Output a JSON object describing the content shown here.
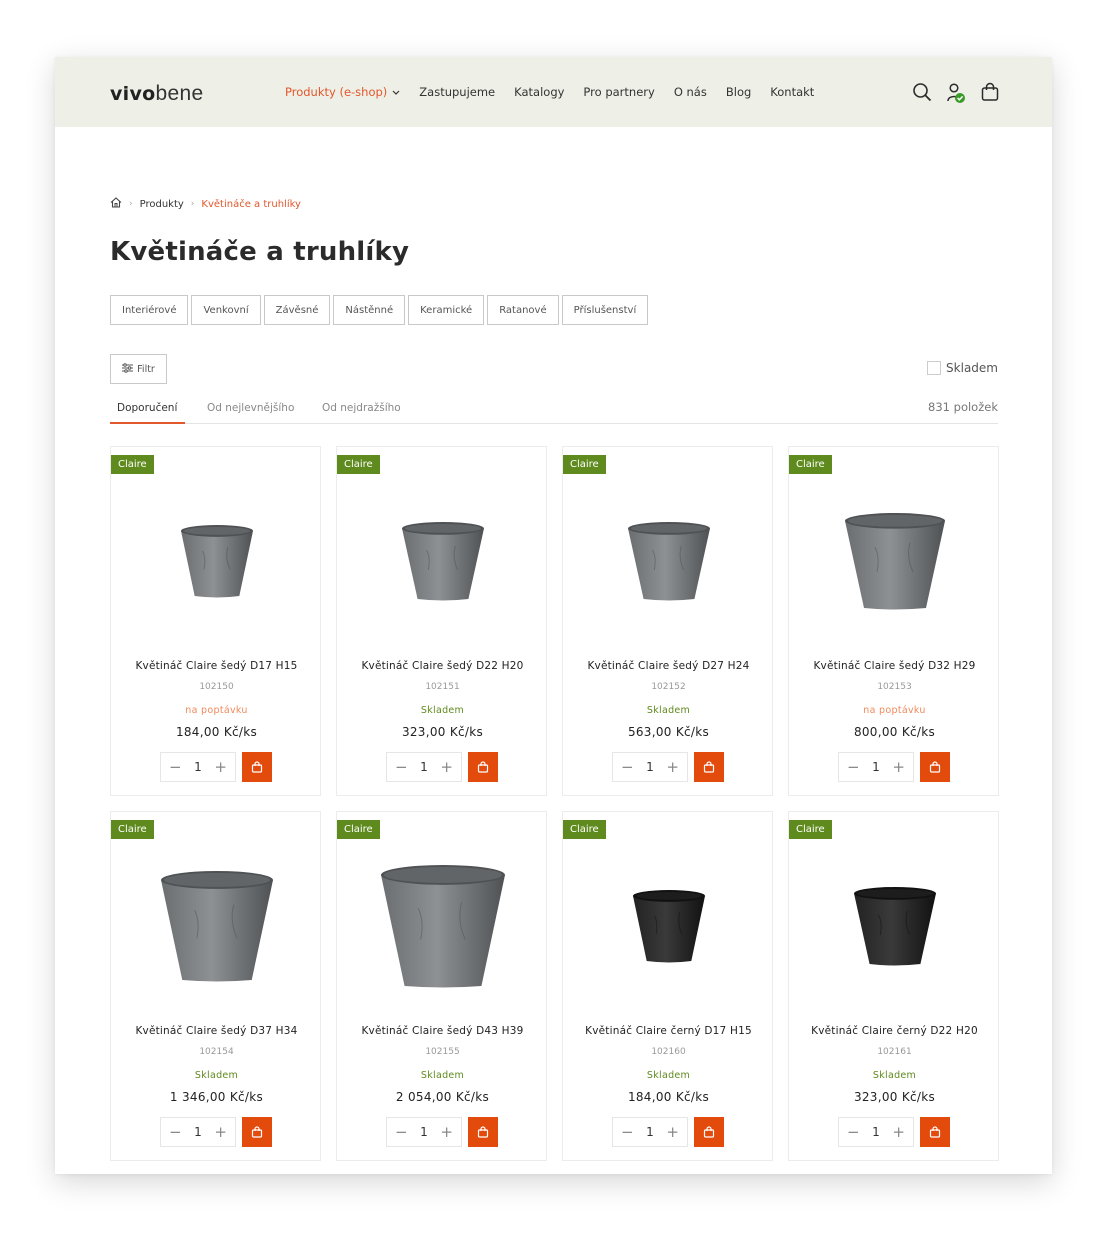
{
  "header": {
    "logo_bold": "vivo",
    "logo_light": "bene",
    "nav": [
      {
        "label": "Produkty (e-shop)",
        "active": true
      },
      {
        "label": "Zastupujeme"
      },
      {
        "label": "Katalogy"
      },
      {
        "label": "Pro partnery"
      },
      {
        "label": "O nás"
      },
      {
        "label": "Blog"
      },
      {
        "label": "Kontakt"
      }
    ],
    "icons": [
      "search-icon",
      "user-icon",
      "cart-icon"
    ]
  },
  "breadcrumb": {
    "home_icon": "home-icon",
    "items": [
      "Produkty",
      "Květináče a truhlíky"
    ]
  },
  "page_title": "Květináče a truhlíky",
  "categories": [
    "Interiérové",
    "Venkovní",
    "Závěsné",
    "Nástěnné",
    "Keramické",
    "Ratanové",
    "Příslušenství"
  ],
  "filter": {
    "label": "Filtr",
    "icon": "sliders-icon"
  },
  "stock_filter": {
    "label": "Skladem",
    "checked": false
  },
  "sort": {
    "tabs": [
      "Doporučení",
      "Od nejlevnějšího",
      "Od nejdražšího"
    ],
    "active": 0
  },
  "count": "831 položek",
  "colors": {
    "accent": "#e2572c",
    "brand_badge": "#5f8a1d",
    "in_stock": "#5f8a1d",
    "on_request": "#f08a5d",
    "cart_button": "#e24b0c",
    "header_bg": "#eef0e7"
  },
  "products": [
    {
      "brand": "Claire",
      "name": "Květináč Claire šedý D17 H15",
      "sku": "102150",
      "availability": "na poptávku",
      "in_stock": false,
      "price": "184,00 Kč/ks",
      "qty": "1",
      "pot_color": "grey",
      "pot_size": "small"
    },
    {
      "brand": "Claire",
      "name": "Květináč Claire šedý D22 H20",
      "sku": "102151",
      "availability": "Skladem",
      "in_stock": true,
      "price": "323,00 Kč/ks",
      "qty": "1",
      "pot_color": "grey",
      "pot_size": "medium"
    },
    {
      "brand": "Claire",
      "name": "Květináč Claire šedý D27 H24",
      "sku": "102152",
      "availability": "Skladem",
      "in_stock": true,
      "price": "563,00 Kč/ks",
      "qty": "1",
      "pot_color": "grey",
      "pot_size": "medium"
    },
    {
      "brand": "Claire",
      "name": "Květináč Claire šedý D32 H29",
      "sku": "102153",
      "availability": "na poptávku",
      "in_stock": false,
      "price": "800,00 Kč/ks",
      "qty": "1",
      "pot_color": "grey",
      "pot_size": "large"
    },
    {
      "brand": "Claire",
      "name": "Květináč Claire šedý D37 H34",
      "sku": "102154",
      "availability": "Skladem",
      "in_stock": true,
      "price": "1 346,00 Kč/ks",
      "qty": "1",
      "pot_color": "grey",
      "pot_size": "xlarge"
    },
    {
      "brand": "Claire",
      "name": "Květináč Claire šedý D43 H39",
      "sku": "102155",
      "availability": "Skladem",
      "in_stock": true,
      "price": "2 054,00 Kč/ks",
      "qty": "1",
      "pot_color": "grey",
      "pot_size": "xxlarge"
    },
    {
      "brand": "Claire",
      "name": "Květináč Claire černý D17 H15",
      "sku": "102160",
      "availability": "Skladem",
      "in_stock": true,
      "price": "184,00 Kč/ks",
      "qty": "1",
      "pot_color": "black",
      "pot_size": "small"
    },
    {
      "brand": "Claire",
      "name": "Květináč Claire černý D22 H20",
      "sku": "102161",
      "availability": "Skladem",
      "in_stock": true,
      "price": "323,00 Kč/ks",
      "qty": "1",
      "pot_color": "black",
      "pot_size": "medium"
    }
  ]
}
